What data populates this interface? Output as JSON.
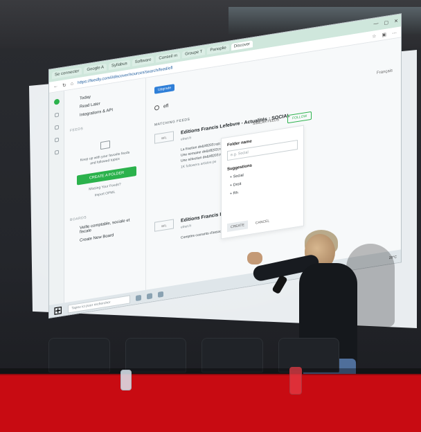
{
  "browser": {
    "tabs": [
      {
        "label": "Se connecter"
      },
      {
        "label": "Google A"
      },
      {
        "label": "Syllabus"
      },
      {
        "label": "Software"
      },
      {
        "label": "Conseil m"
      },
      {
        "label": "Groupe T"
      },
      {
        "label": "Panoplie"
      },
      {
        "label": "Discover"
      }
    ],
    "url": "https://feedly.com/i/discover/sources/search/feed/efl"
  },
  "feedly": {
    "leftnav": {
      "items": [
        "Today",
        "Read Later",
        "Integrations & API"
      ],
      "feeds_section": "FEEDS",
      "empty_text": "Keep up with your favorite feeds and followed topics",
      "create_folder_label": "CREATE A FOLDER",
      "missing_feeds_label": "Missing Your Feeds?",
      "import_label": "Import OPML",
      "boards_section": "BOARDS",
      "boards_items": [
        "Veille comptable, sociale et fiscale",
        "Create New Board"
      ]
    },
    "main": {
      "upgrade_label": "Upgrade",
      "search_value": "efl",
      "language": "Français",
      "matching_label": "MATCHING FEEDS",
      "feeds": [
        {
          "title": "Editions Francis Lefebvre - Actualités : SOCIAL",
          "sub": "elnet.fr",
          "bullets": [
            "La fraction de&#8203;rop;sal",
            "Une semaine de&#8203;nbsp;&",
            "Une sélection de&#8203;nbsp;"
          ],
          "followers": "1K",
          "followers_label": "followers",
          "articles_label": "articles pe"
        },
        {
          "title": "Editions Francis Lefebvre - Actualités : FISCAL",
          "sub": "elnet.fr",
          "bullets": [
            "Comptes courants d'associés&#8203;nbsp; faut maintenir d'intérêts de..."
          ]
        }
      ],
      "similar_label": "SIMILAR FEEDS",
      "follow_label": "FOLLOW",
      "popover": {
        "folder_name_label": "Folder name",
        "folder_name_placeholder": "e.g. Social",
        "suggestions_label": "Suggestions",
        "suggestions": [
          "Social",
          "Droit",
          "Rh"
        ],
        "create_label": "CREATE",
        "cancel_label": "CANCEL"
      }
    }
  },
  "taskbar": {
    "search_placeholder": "Tapez ici pour rechercher",
    "temp": "20°C"
  },
  "colors": {
    "accent": "#2bb24c",
    "desk": "#c80b12",
    "screen": "#e9edf0"
  }
}
